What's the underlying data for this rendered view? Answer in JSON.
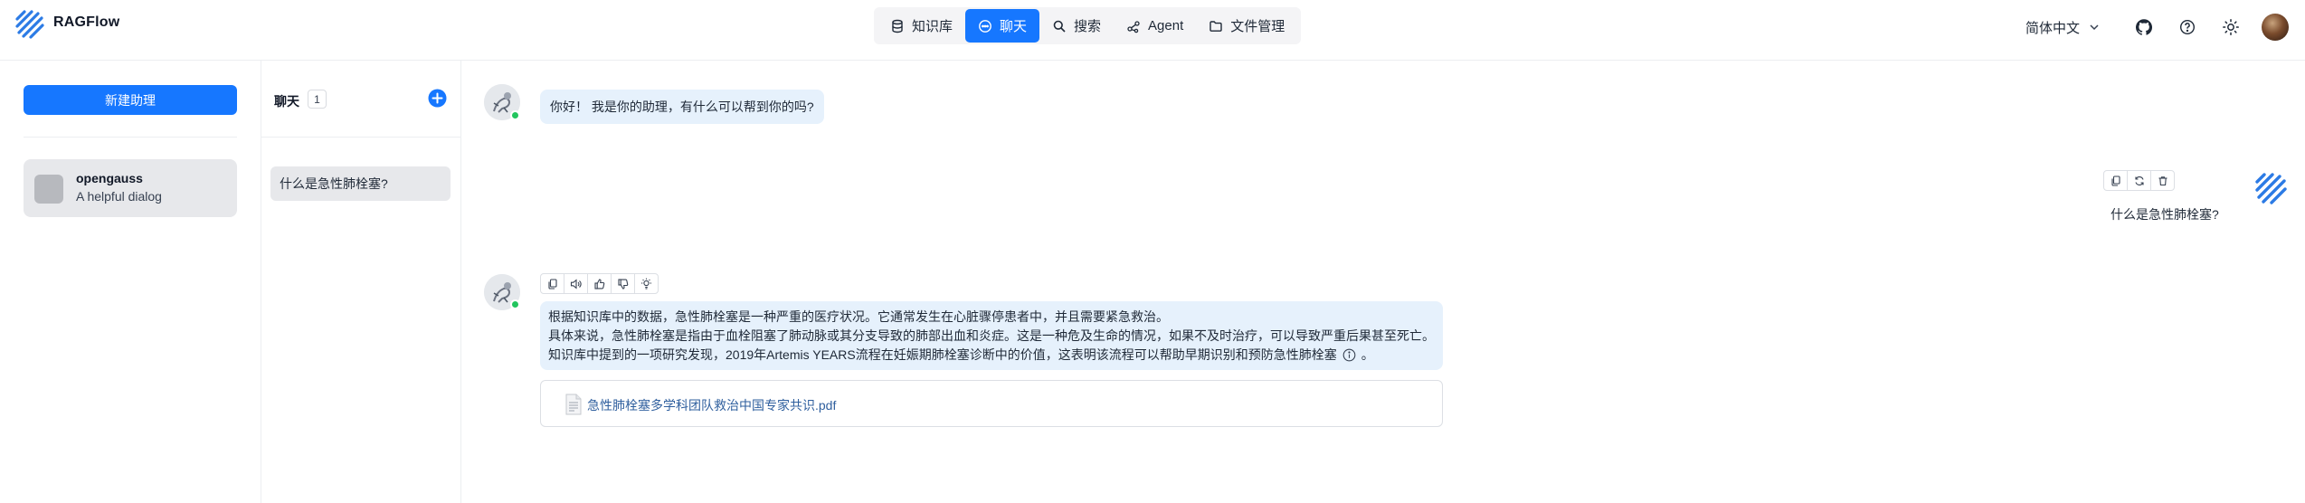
{
  "app": {
    "brand": "RAGFlow"
  },
  "nav": [
    {
      "label": "知识库",
      "icon": "database-icon",
      "active": false
    },
    {
      "label": "聊天",
      "icon": "chat-bubble-icon",
      "active": true
    },
    {
      "label": "搜索",
      "icon": "search-icon",
      "active": false
    },
    {
      "label": "Agent",
      "icon": "agent-graph-icon",
      "active": false
    },
    {
      "label": "文件管理",
      "icon": "folder-icon",
      "active": false
    }
  ],
  "header_right": {
    "language": "简体中文"
  },
  "left_panel": {
    "new_button": "新建助理",
    "assistant": {
      "name": "opengauss",
      "description": "A helpful dialog"
    }
  },
  "middle_panel": {
    "title": "聊天",
    "count": "1",
    "conversation": "什么是急性肺栓塞?"
  },
  "messages": {
    "greeting": "你好！ 我是你的助理，有什么可以帮到你的吗?",
    "user_question": "什么是急性肺栓塞?",
    "answer_lines": [
      "根据知识库中的数据，急性肺栓塞是一种严重的医疗状况。它通常发生在心脏骤停患者中，并且需要紧急救治。",
      "具体来说，急性肺栓塞是指由于血栓阻塞了肺动脉或其分支导致的肺部出血和炎症。这是一种危及生命的情况，如果不及时治疗，可以导致严重后果甚至死亡。",
      "知识库中提到的一项研究发现，2019年Artemis YEARS流程在妊娠期肺栓塞诊断中的价值，这表明该流程可以帮助早期识别和预防急性肺栓塞"
    ],
    "answer_end": "。",
    "reference_file": "急性肺栓塞多学科团队救治中国专家共识.pdf"
  },
  "colors": {
    "accent": "#1677ff",
    "bubble": "#e6f1fc",
    "online": "#22c55e",
    "link": "#2f5f9e"
  }
}
